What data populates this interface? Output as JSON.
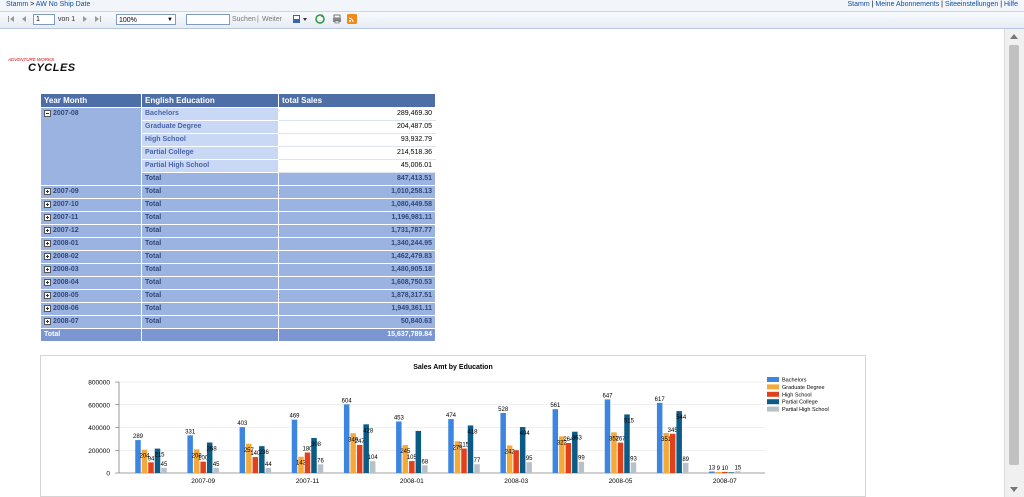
{
  "breadcrumb": {
    "home": "Stamm",
    "sep": ">",
    "report": "AW No Ship Date"
  },
  "top_links": [
    "Stamm",
    "Meine Abonnements",
    "Siteeinstellungen",
    "Hilfe"
  ],
  "toolbar": {
    "page_value": "1",
    "page_of": "von 1",
    "zoom": "100%",
    "search_value": "",
    "find_label": "Suchen",
    "find_sep": "|",
    "next_label": "Weiter"
  },
  "logo": {
    "tagline": "ADVENTURE WORKS",
    "name": "CYCLES"
  },
  "table": {
    "headers": [
      "Year Month",
      "English Education",
      "total Sales"
    ],
    "expanded": {
      "label": "2007-08",
      "rows": [
        {
          "edu": "Bachelors",
          "value": "289,469.30"
        },
        {
          "edu": "Graduate Degree",
          "value": "204,487.05"
        },
        {
          "edu": "High School",
          "value": "93,932.79"
        },
        {
          "edu": "Partial College",
          "value": "214,518.36"
        },
        {
          "edu": "Partial High School",
          "value": "45,006.01"
        }
      ],
      "total_label": "Total",
      "total": "847,413.51"
    },
    "collapsed": [
      {
        "label": "2007-09",
        "total_label": "Total",
        "total": "1,010,258.13"
      },
      {
        "label": "2007-10",
        "total_label": "Total",
        "total": "1,080,449.58"
      },
      {
        "label": "2007-11",
        "total_label": "Total",
        "total": "1,196,981.11"
      },
      {
        "label": "2007-12",
        "total_label": "Total",
        "total": "1,731,787.77"
      },
      {
        "label": "2008-01",
        "total_label": "Total",
        "total": "1,340,244.95"
      },
      {
        "label": "2008-02",
        "total_label": "Total",
        "total": "1,462,479.83"
      },
      {
        "label": "2008-03",
        "total_label": "Total",
        "total": "1,480,905.18"
      },
      {
        "label": "2008-04",
        "total_label": "Total",
        "total": "1,608,750.53"
      },
      {
        "label": "2008-05",
        "total_label": "Total",
        "total": "1,878,317.51"
      },
      {
        "label": "2008-06",
        "total_label": "Total",
        "total": "1,949,361.11"
      },
      {
        "label": "2008-07",
        "total_label": "Total",
        "total": "50,840.63"
      }
    ],
    "grand_label": "Total",
    "grand_total": "15,637,789.84"
  },
  "chart_data": {
    "type": "bar",
    "title": "Sales Amt by Education",
    "categories": [
      "2007-08",
      "2007-09",
      "2007-10",
      "2007-11",
      "2007-12",
      "2008-01",
      "2008-02",
      "2008-03",
      "2008-04",
      "2008-05",
      "2008-06",
      "2008-07"
    ],
    "x_tick_labels": [
      "2007-09",
      "2007-11",
      "2008-01",
      "2008-03",
      "2008-05",
      "2008-07"
    ],
    "ylim": [
      0,
      800000
    ],
    "yticks": [
      0,
      200000,
      400000,
      600000,
      800000
    ],
    "ytick_labels": [
      "0",
      "200000",
      "400000",
      "600000",
      "800000"
    ],
    "legend_position": "right",
    "series": [
      {
        "name": "Bachelors",
        "color": "#3d86e0",
        "values": [
          289469,
          331000,
          403000,
          469000,
          604000,
          453000,
          474000,
          528000,
          561000,
          647000,
          617000,
          13000
        ],
        "labels": [
          "289",
          "331",
          "403",
          "469",
          "604",
          "453",
          "474",
          "528",
          "561",
          "647",
          "617",
          "13"
        ]
      },
      {
        "name": "Graduate Degree",
        "color": "#f5a93a",
        "values": [
          204487,
          208000,
          257000,
          143000,
          349000,
          245000,
          279000,
          242000,
          322000,
          357000,
          351000,
          9000
        ],
        "labels": [
          "204",
          "208",
          "257",
          "143",
          "349",
          "245",
          "279",
          "242",
          "322",
          "357",
          "351",
          "9"
        ]
      },
      {
        "name": "High School",
        "color": "#e2401a",
        "values": [
          93933,
          100000,
          140000,
          180000,
          247000,
          105000,
          215000,
          200000,
          264000,
          267000,
          345000,
          10000
        ],
        "labels": [
          "94",
          "100",
          "140",
          "180",
          "247",
          "105",
          "215",
          "",
          "264",
          "267",
          "345",
          "10"
        ]
      },
      {
        "name": "Partial College",
        "color": "#0c5a86",
        "values": [
          214518,
          268000,
          236000,
          308000,
          428000,
          370000,
          418000,
          404000,
          363000,
          515000,
          544000,
          6000
        ],
        "labels": [
          "215",
          "268",
          "236",
          "308",
          "428",
          "",
          "418",
          "404",
          "363",
          "515",
          "544",
          ""
        ]
      },
      {
        "name": "Partial High School",
        "color": "#b8c0c8",
        "values": [
          45006,
          45000,
          44000,
          76000,
          104000,
          68000,
          77000,
          95000,
          99000,
          93000,
          89000,
          15000
        ],
        "labels": [
          "45",
          "45",
          "44",
          "76",
          "104",
          "68",
          "77",
          "95",
          "99",
          "93",
          "89",
          "15"
        ]
      }
    ]
  }
}
